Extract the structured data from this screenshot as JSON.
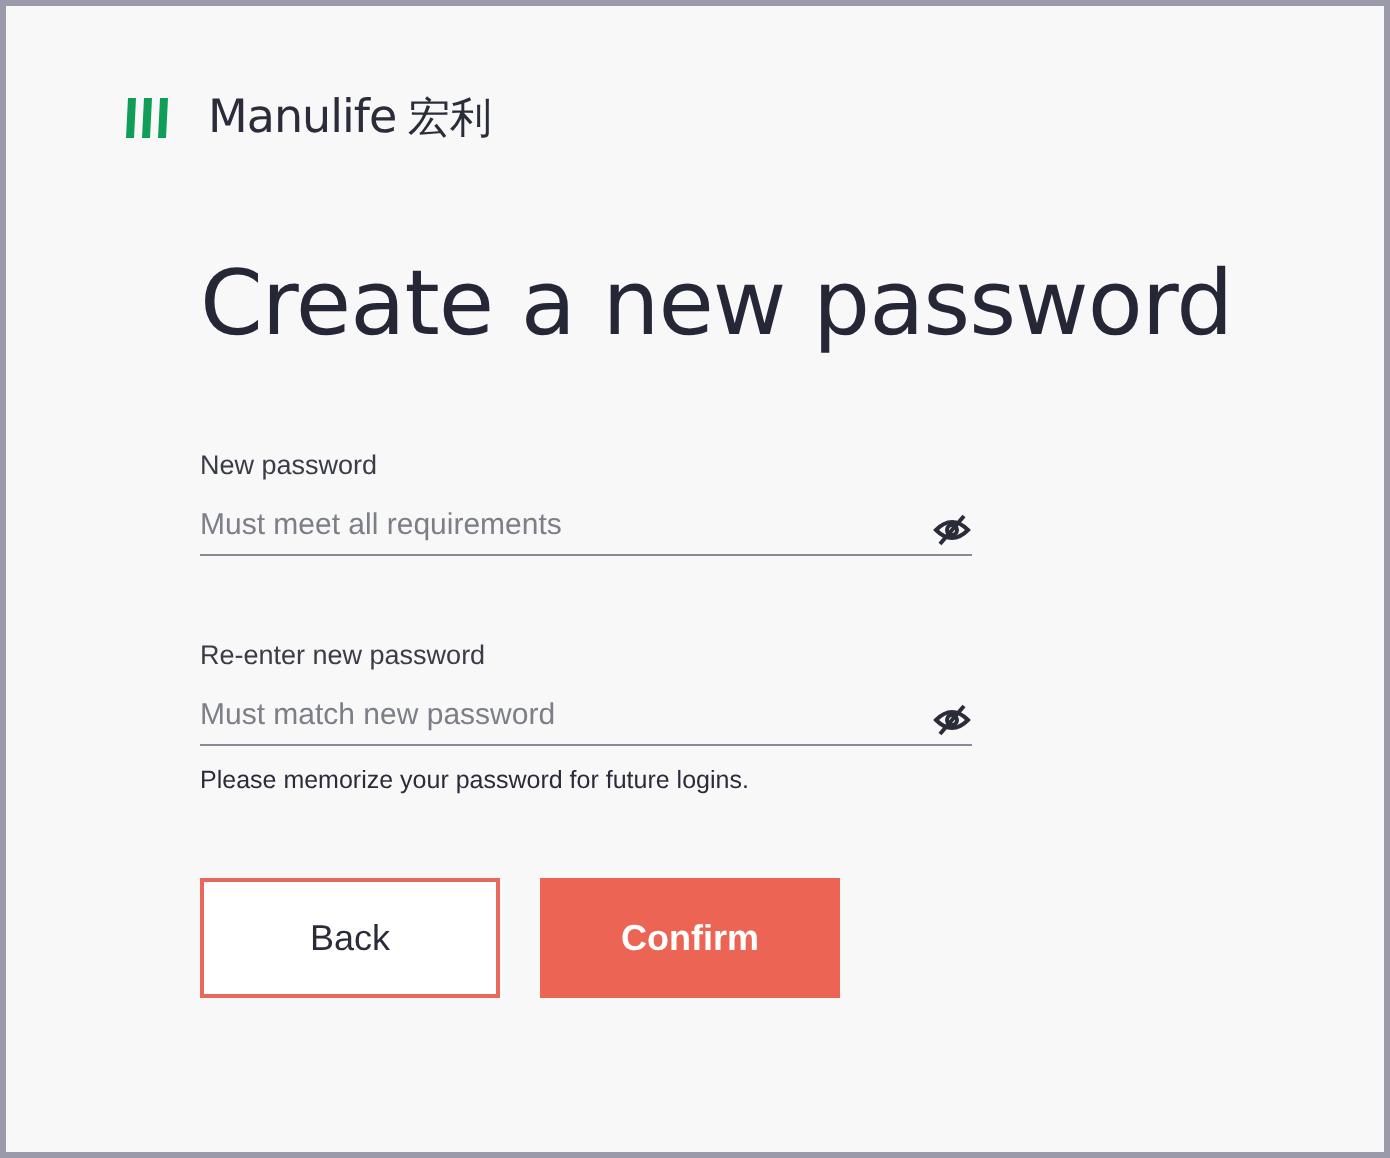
{
  "logo": {
    "name": "Manulife",
    "chinese_name": "宏利"
  },
  "title": "Create a new password",
  "fields": [
    {
      "label": "New password",
      "placeholder": "Must meet all requirements"
    },
    {
      "label": "Re-enter new password",
      "placeholder": "Must match new password",
      "hint": "Please memorize your password for future logins."
    }
  ],
  "buttons": [
    {
      "label": "Back",
      "kind": "secondary"
    },
    {
      "label": "Confirm",
      "kind": "primary"
    }
  ]
}
